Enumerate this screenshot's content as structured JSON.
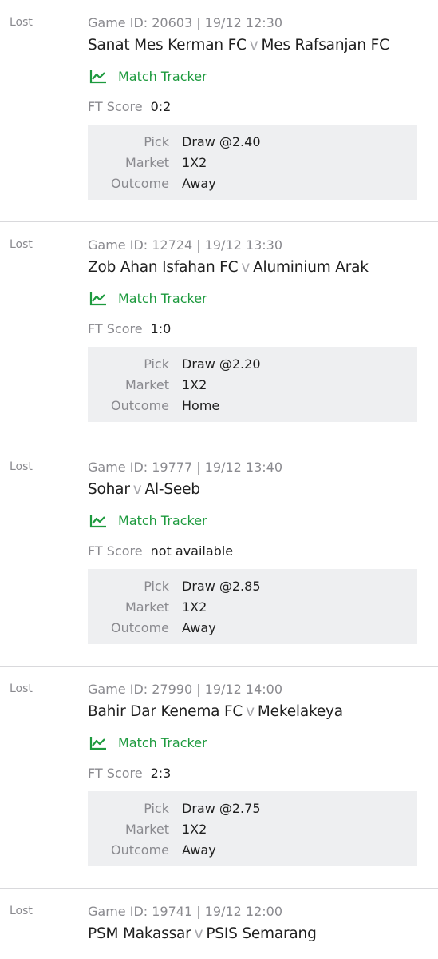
{
  "labels": {
    "match_tracker": "Match Tracker",
    "ft_score": "FT Score",
    "pick": "Pick",
    "market": "Market",
    "outcome": "Outcome",
    "vs": "v"
  },
  "colors": {
    "accent_green": "#1d9a3e",
    "muted_text": "#8a8a8f",
    "detail_bg": "#eeeff1"
  },
  "bets": [
    {
      "status": "Lost",
      "meta": "Game ID: 20603 | 19/12 12:30",
      "home": "Sanat Mes Kerman FC",
      "away": "Mes Rafsanjan FC",
      "score": "0:2",
      "pick": "Draw @2.40",
      "market": "1X2",
      "outcome": "Away"
    },
    {
      "status": "Lost",
      "meta": "Game ID: 12724 | 19/12 13:30",
      "home": "Zob Ahan Isfahan FC",
      "away": "Aluminium Arak",
      "score": "1:0",
      "pick": "Draw @2.20",
      "market": "1X2",
      "outcome": "Home"
    },
    {
      "status": "Lost",
      "meta": "Game ID: 19777 | 19/12 13:40",
      "home": "Sohar",
      "away": "Al-Seeb",
      "score": "not available",
      "pick": "Draw @2.85",
      "market": "1X2",
      "outcome": "Away"
    },
    {
      "status": "Lost",
      "meta": "Game ID: 27990 | 19/12 14:00",
      "home": "Bahir Dar Kenema FC",
      "away": "Mekelakeya",
      "score": "2:3",
      "pick": "Draw @2.75",
      "market": "1X2",
      "outcome": "Away"
    },
    {
      "status": "Lost",
      "meta": "Game ID: 19741 | 19/12 12:00",
      "home": "PSM Makassar",
      "away": "PSIS Semarang"
    }
  ]
}
